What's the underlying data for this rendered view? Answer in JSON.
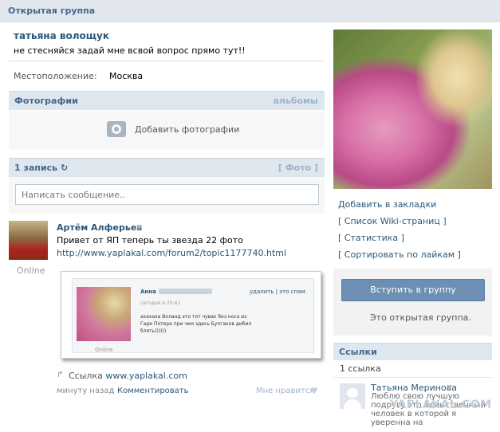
{
  "topbar": {
    "title": "Открытая группа"
  },
  "group": {
    "name": "татьяна волощук",
    "status": "не стесняйся задай мне всвой вопрос прямо тут!!",
    "location_label": "Местоположение:",
    "location_value": "Москва"
  },
  "photos": {
    "title": "Фотографии",
    "albums_link": "альбомы",
    "add_label": "Добавить фотографии"
  },
  "wall": {
    "title": "1 запись",
    "photo_link": "[ Фото ]",
    "input_placeholder": "Написать сообщение.."
  },
  "post": {
    "author": "Артём Алферьев",
    "online": "Online",
    "text": "Привет от ЯП теперь ты звезда 22 фото",
    "link": "http://www.yaplakal.com/forum2/topic1177740.html",
    "source_label": "Ссылка",
    "source_domain": "www.yaplakal.com",
    "time": "минуту назад",
    "comment": "Комментировать",
    "like": "Мне нравится"
  },
  "embedded_screenshot": {
    "name": "Анна",
    "actions": "удалить | это спам",
    "time": "сегодня в 20:41",
    "text": "ахахаха Воланд это тот чувак без носа из Гари Потера при чем здесь Булгаков дибил блять))))))",
    "online": "Online"
  },
  "sidebar": {
    "links": [
      "Добавить в закладки",
      "[ Список Wiki-страниц ]",
      "[ Статистика ]",
      "[ Сортировать по лайкам ]"
    ],
    "join_button": "Вступить в группу",
    "open_group_text": "Это открытая группа.",
    "links_section": {
      "title": "Ссылки",
      "count": "1 ссылка",
      "item": {
        "name": "Татьяна Меринова",
        "description": "Люблю свою лучшую подругу это единственный человек в которой я уверенна на"
      }
    },
    "watermark": "YAPLAKAL.COM"
  },
  "colors": {
    "link": "#2b587a",
    "header_bg": "#dee6ee",
    "button_bg": "#6d8fb3"
  }
}
